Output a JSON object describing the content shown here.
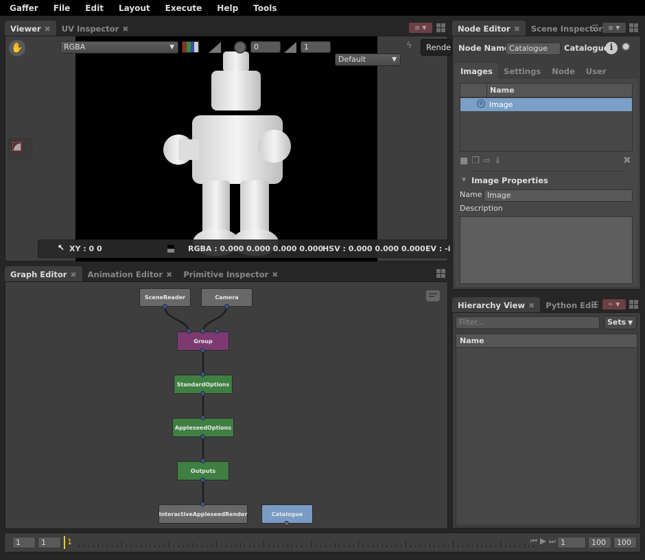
{
  "menu": [
    "Gaffer",
    "File",
    "Edit",
    "Layout",
    "Execute",
    "Help",
    "Tools"
  ],
  "viewer": {
    "tabs": [
      {
        "label": "Viewer",
        "active": true
      },
      {
        "label": "UV Inspector",
        "active": false
      }
    ],
    "channel_select": "RGBA",
    "exposure": "0",
    "gamma": "1",
    "display_transform": "Default",
    "render_button": "Render",
    "status": {
      "xy": "XY : 0 0",
      "rgba": "RGBA : 0.000 0.000 0.000 0.000",
      "hsv": "HSV : 0.000 0.000 0.000",
      "ev": "EV : -i"
    }
  },
  "graph_editor": {
    "tabs": [
      {
        "label": "Graph Editor",
        "active": true
      },
      {
        "label": "Animation Editor",
        "active": false
      },
      {
        "label": "Primitive Inspector",
        "active": false
      }
    ],
    "nodes": [
      {
        "name": "SceneReader",
        "color": "#686868"
      },
      {
        "name": "Camera",
        "color": "#686868"
      },
      {
        "name": "Group",
        "color": "#7c3a70"
      },
      {
        "name": "StandardOptions",
        "color": "#3f7f42"
      },
      {
        "name": "AppleseedOptions",
        "color": "#3f7f42"
      },
      {
        "name": "Outputs",
        "color": "#3f7f42"
      },
      {
        "name": "InteractiveAppleseedRender",
        "color": "#686868"
      },
      {
        "name": "Catalogue",
        "color": "#789cc4"
      }
    ]
  },
  "node_editor": {
    "tabs": [
      {
        "label": "Node Editor",
        "active": true
      },
      {
        "label": "Scene Inspector",
        "active": false
      }
    ],
    "node_name_label": "Node Name",
    "node_name_value": "Catalogue",
    "node_type": "Catalogue",
    "subtabs": [
      {
        "label": "Images",
        "active": true
      },
      {
        "label": "Settings",
        "active": false
      },
      {
        "label": "Node",
        "active": false
      },
      {
        "label": "User",
        "active": false
      }
    ],
    "images_table": {
      "header": "Name",
      "rows": [
        {
          "name": "Image",
          "selected": true
        }
      ]
    },
    "image_properties": {
      "title": "Image Properties",
      "name_label": "Name",
      "name_value": "Image",
      "description_label": "Description",
      "description_value": ""
    }
  },
  "hierarchy": {
    "tabs": [
      {
        "label": "Hierarchy View",
        "active": true
      },
      {
        "label": "Python Editor",
        "active": false
      }
    ],
    "filter_placeholder": "Filter...",
    "sets_button": "Sets",
    "column_header": "Name"
  },
  "timeline": {
    "start_field": "1",
    "end_start_field": "1",
    "current_frame": "1",
    "frame_field": "1",
    "end_field": "100",
    "range_end_field": "100"
  },
  "colors": {
    "accent_selection": "#7aa0c8",
    "playhead": "#e8d020"
  }
}
